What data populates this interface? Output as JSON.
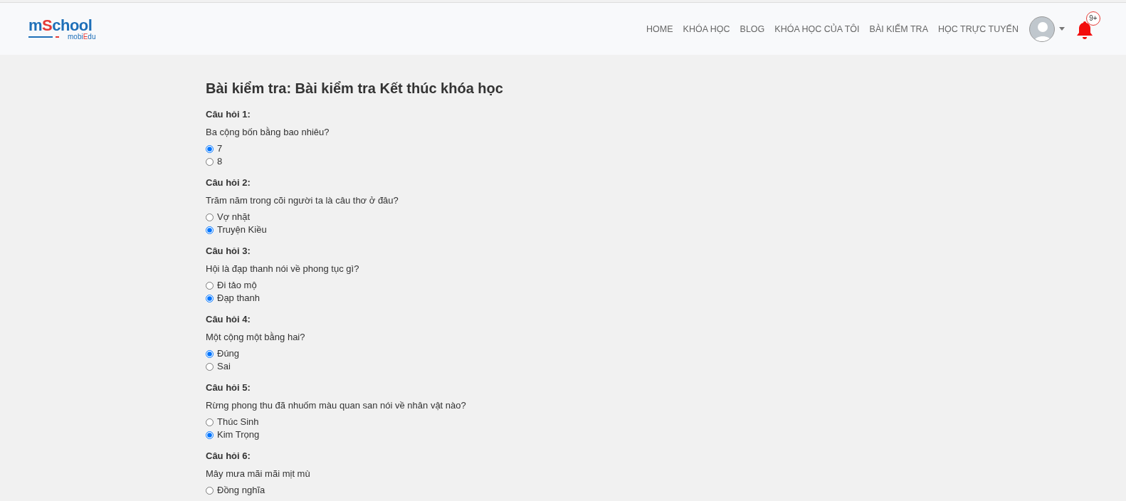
{
  "logo": {
    "title_parts": [
      "m",
      "S",
      "chool"
    ],
    "tagline_parts": [
      "mobi",
      "E",
      "du"
    ]
  },
  "nav": [
    {
      "label": "HOME"
    },
    {
      "label": "KHÓA HỌC"
    },
    {
      "label": "BLOG"
    },
    {
      "label": "KHÓA HỌC CỦA TÔI"
    },
    {
      "label": "BÀI KIỂM TRA"
    },
    {
      "label": "HỌC TRỰC TUYẾN"
    }
  ],
  "notifications": {
    "badge": "9+"
  },
  "title": "Bài kiểm tra: Bài kiểm tra Kết thúc khóa học",
  "questions": [
    {
      "label": "Câu hỏi 1:",
      "text": "Ba cộng bốn bằng bao nhiêu?",
      "options": [
        {
          "label": "7",
          "selected": true
        },
        {
          "label": "8",
          "selected": false
        }
      ]
    },
    {
      "label": "Câu hỏi 2:",
      "text": "Trăm năm trong cõi người ta là câu thơ ở đâu?",
      "options": [
        {
          "label": "Vợ nhặt",
          "selected": false
        },
        {
          "label": "Truyện Kiều",
          "selected": true
        }
      ]
    },
    {
      "label": "Câu hỏi 3:",
      "text": "Hội là đạp thanh nói về phong tục gì?",
      "options": [
        {
          "label": "Đi tảo mộ",
          "selected": false
        },
        {
          "label": "Đạp thanh",
          "selected": true
        }
      ]
    },
    {
      "label": "Câu hỏi 4:",
      "text": "Một cộng một bằng hai?",
      "options": [
        {
          "label": "Đúng",
          "selected": true
        },
        {
          "label": "Sai",
          "selected": false
        }
      ]
    },
    {
      "label": "Câu hỏi 5:",
      "text": "Rừng phong thu đã nhuốm màu quan san nói về nhân vật nào?",
      "options": [
        {
          "label": "Thúc Sinh",
          "selected": false
        },
        {
          "label": "Kim Trọng",
          "selected": true
        }
      ]
    },
    {
      "label": "Câu hỏi 6:",
      "text": "Mây mưa mãi mãi mịt mù",
      "options": [
        {
          "label": "Đồng nghĩa",
          "selected": false
        }
      ]
    }
  ]
}
